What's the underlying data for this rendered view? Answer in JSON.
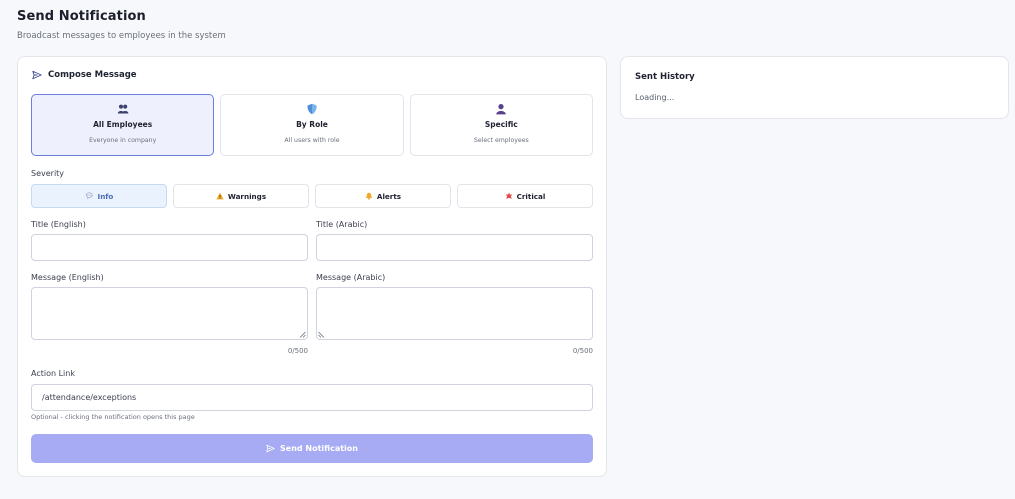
{
  "page": {
    "title": "Send Notification",
    "subtitle": "Broadcast messages to employees in the system"
  },
  "compose": {
    "header": "Compose Message",
    "header_icon": "send-icon",
    "targets": [
      {
        "label": "All Employees",
        "desc": "Everyone in company",
        "icon": "users-icon",
        "selected": true
      },
      {
        "label": "By Role",
        "desc": "All users with role",
        "icon": "shield-icon",
        "selected": false
      },
      {
        "label": "Specific",
        "desc": "Select employees",
        "icon": "user-icon",
        "selected": false
      }
    ],
    "severity_label": "Severity",
    "severities": [
      {
        "label": "Info",
        "icon": "info-bubble-icon",
        "selected": true
      },
      {
        "label": "Warnings",
        "icon": "warning-icon",
        "selected": false
      },
      {
        "label": "Alerts",
        "icon": "bell-icon",
        "selected": false
      },
      {
        "label": "Critical",
        "icon": "critical-icon",
        "selected": false
      }
    ],
    "title_en_label": "Title (English)",
    "title_en_value": "",
    "title_ar_label": "Title (Arabic)",
    "title_ar_value": "",
    "message_en_label": "Message (English)",
    "message_ar_label": "Message (Arabic)",
    "message_en_counter": "0/500",
    "message_ar_counter": "0/500",
    "action_link_label": "Action Link",
    "action_link_value": "/attendance/exceptions",
    "action_link_hint": "Optional - clicking the notification opens this page",
    "send_label": "Send Notification"
  },
  "history": {
    "title": "Sent History",
    "status": "Loading..."
  },
  "colors": {
    "accent": "#6b7de0",
    "send_button_disabled": "#a6abf4",
    "info_selected_bg": "#eaf2fd"
  }
}
